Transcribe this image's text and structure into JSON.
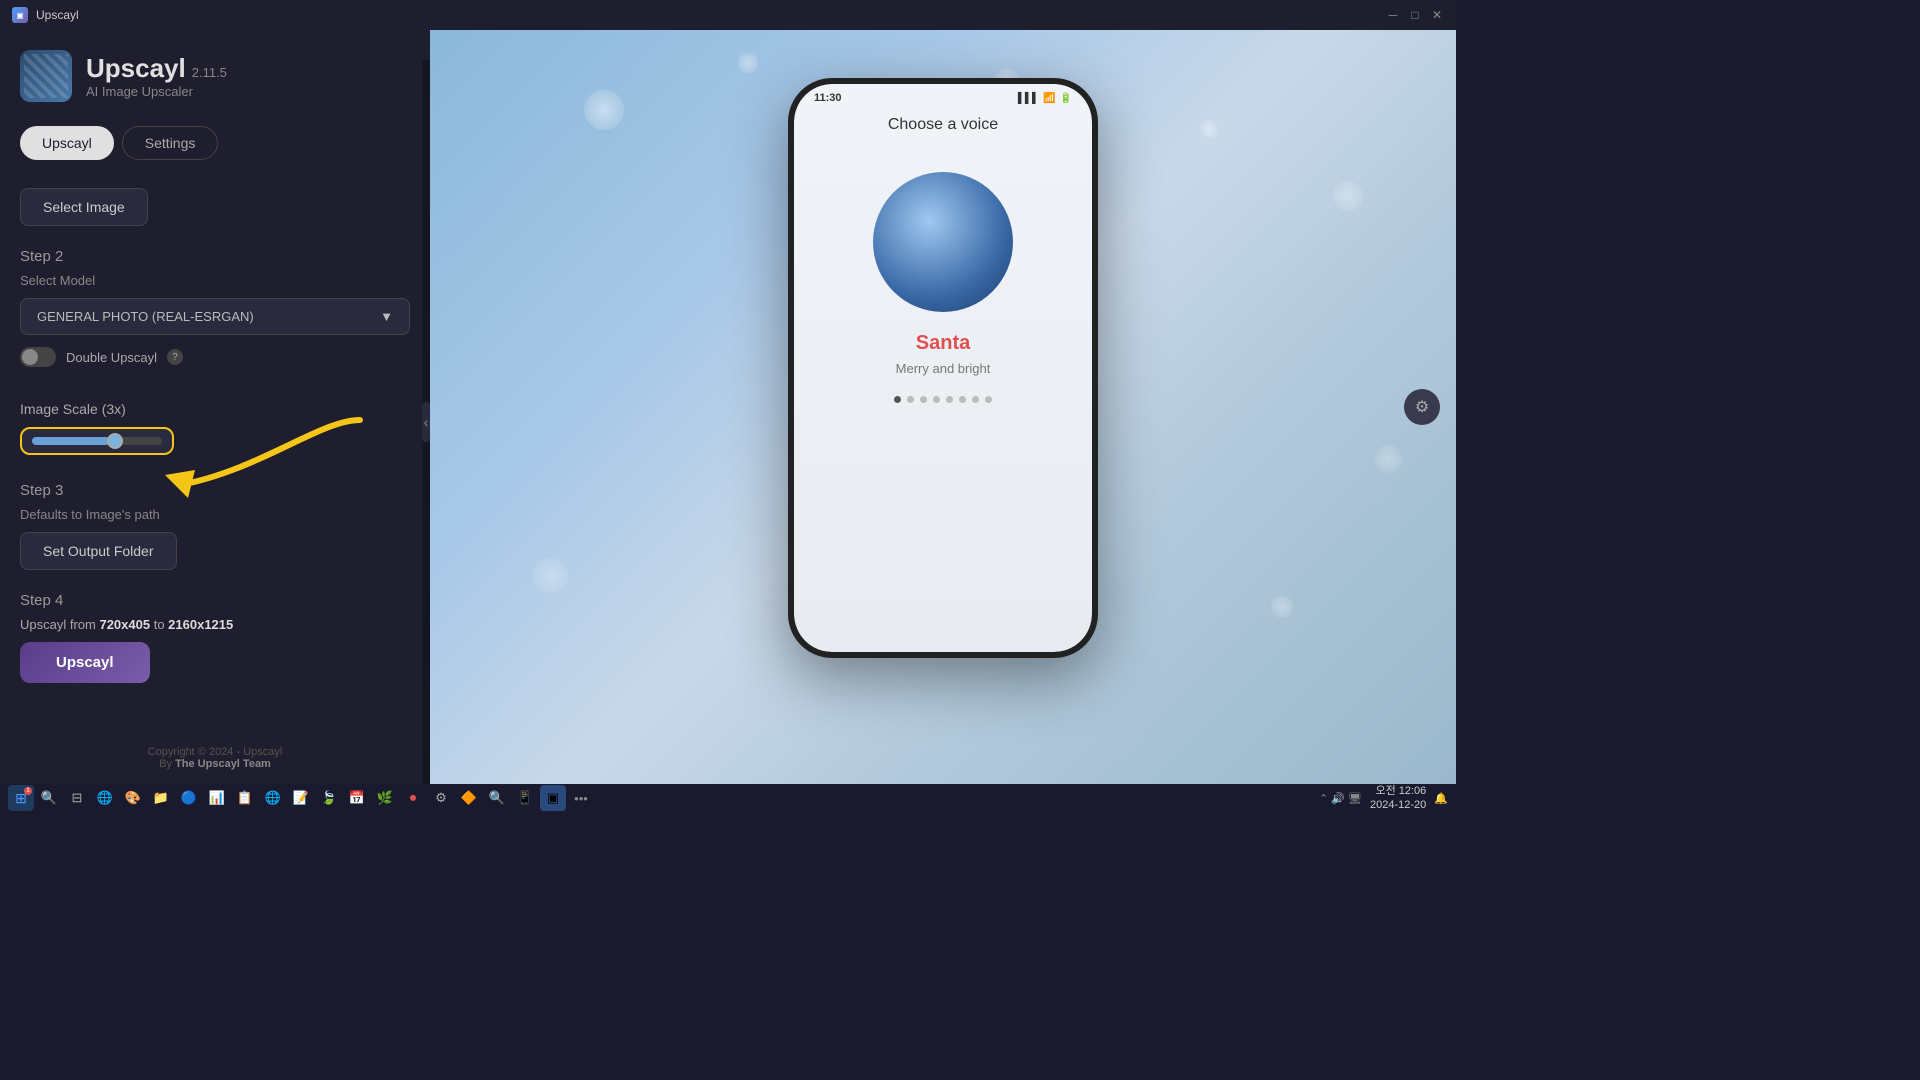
{
  "app": {
    "title": "Upscayl",
    "version": "2.11.5",
    "subtitle": "AI Image Upscaler"
  },
  "titlebar": {
    "title": "Upscayl",
    "minimize": "─",
    "maximize": "□",
    "close": "✕"
  },
  "nav": {
    "tabs": [
      {
        "id": "upscayl",
        "label": "Upscayl",
        "active": true
      },
      {
        "id": "settings",
        "label": "Settings",
        "active": false
      }
    ]
  },
  "step1": {
    "label": "Select Image"
  },
  "step2": {
    "number": "Step 2",
    "label": "Select Model",
    "model": "GENERAL PHOTO (REAL-ESRGAN)",
    "double_upscayl": "Double Upscayl",
    "help": "?"
  },
  "scale": {
    "label": "Image Scale (3x)"
  },
  "step3": {
    "number": "Step 3",
    "label": "Defaults to Image's path",
    "button": "Set Output Folder"
  },
  "step4": {
    "number": "Step 4",
    "prefix": "Upscayl from ",
    "from": "720x405",
    "to": " to ",
    "to_size": "2160x1215",
    "button": "Upscayl"
  },
  "copyright": {
    "text": "Copyright © 2024 - Upscayl",
    "team": "The Upscayl Team"
  },
  "phone": {
    "time": "11:30",
    "title": "Choose a voice",
    "name": "Santa",
    "tagline": "Merry and bright"
  },
  "taskbar": {
    "time_line1": "오전 12:06",
    "time_line2": "2024-12-20"
  }
}
